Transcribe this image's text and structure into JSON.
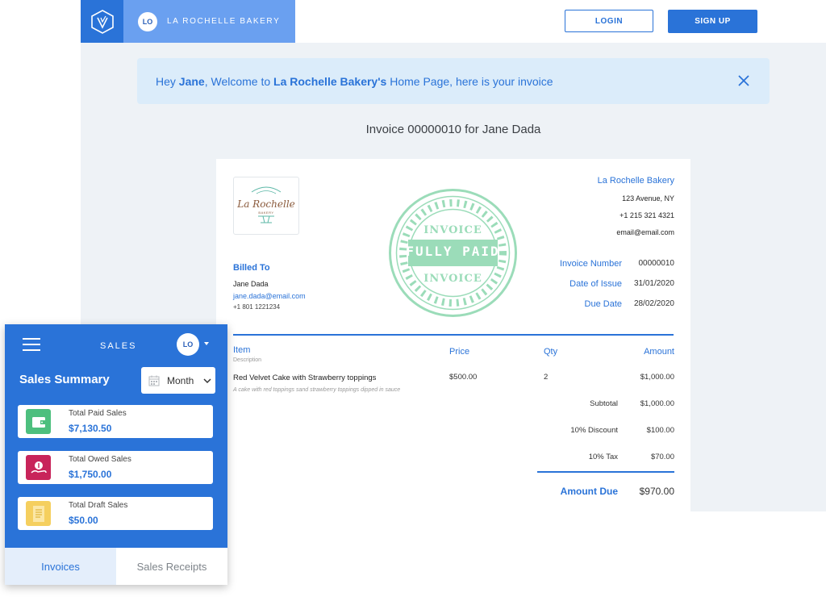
{
  "app": {
    "brand_initials": "LO",
    "brand_name": "LA ROCHELLE BAKERY",
    "login_label": "LOGIN",
    "signup_label": "SIGN UP"
  },
  "banner": {
    "prefix": "Hey ",
    "user": "Jane",
    "middle": ", Welcome to ",
    "business": "La Rochelle Bakery's",
    "suffix": " Home Page, here is your invoice"
  },
  "invoice_title": "Invoice 00000010 for Jane Dada",
  "invoice": {
    "logo_text_1": "La Rochelle",
    "logo_text_2": "BAKERY",
    "business_name": "La Rochelle Bakery",
    "address": "123 Avenue, NY",
    "phone": "+1 215 321 4321",
    "email": "email@email.com",
    "billed_to_label": "Billed To",
    "client_name": "Jane Dada",
    "client_email": "jane.dada@email.com",
    "client_phone": "+1 801 1221234",
    "stamp_top": "INVOICE",
    "stamp_middle": "FULLY PAID",
    "stamp_bottom": "INVOICE",
    "invoice_number_label": "Invoice Number",
    "invoice_number": "00000010",
    "issue_label": "Date of Issue",
    "issue_date": "31/01/2020",
    "due_label": "Due Date",
    "due_date": "28/02/2020",
    "columns": {
      "item": "Item",
      "description": "Description",
      "price": "Price",
      "qty": "Qty",
      "amount": "Amount"
    },
    "items": [
      {
        "name": "Red Velvet Cake with Strawberry toppings",
        "description": "A cake with red toppings sand strawberry toppings dipped in sauce",
        "price": "$500.00",
        "qty": "2",
        "amount": "$1,000.00"
      }
    ],
    "subtotal_label": "Subtotal",
    "subtotal": "$1,000.00",
    "discount_label": "10% Discount",
    "discount": "$100.00",
    "tax_label": "10% Tax",
    "tax": "$70.00",
    "amount_due_label": "Amount Due",
    "amount_due": "$970.00"
  },
  "sales_panel": {
    "title": "SALES",
    "avatar_initials": "LO",
    "summary_title": "Sales Summary",
    "period": "Month",
    "cards": [
      {
        "label": "Total Paid Sales",
        "value": "$7,130.50",
        "color": "#4dbf7e",
        "icon": "wallet-icon"
      },
      {
        "label": "Total Owed Sales",
        "value": "$1,750.00",
        "color": "#c8245a",
        "icon": "money-hand-icon"
      },
      {
        "label": "Total Draft Sales",
        "value": "$50.00",
        "color": "#f5cf5e",
        "icon": "draft-document-icon"
      }
    ],
    "tabs": [
      {
        "label": "Invoices",
        "active": true
      },
      {
        "label": "Sales Receipts",
        "active": false
      }
    ]
  }
}
